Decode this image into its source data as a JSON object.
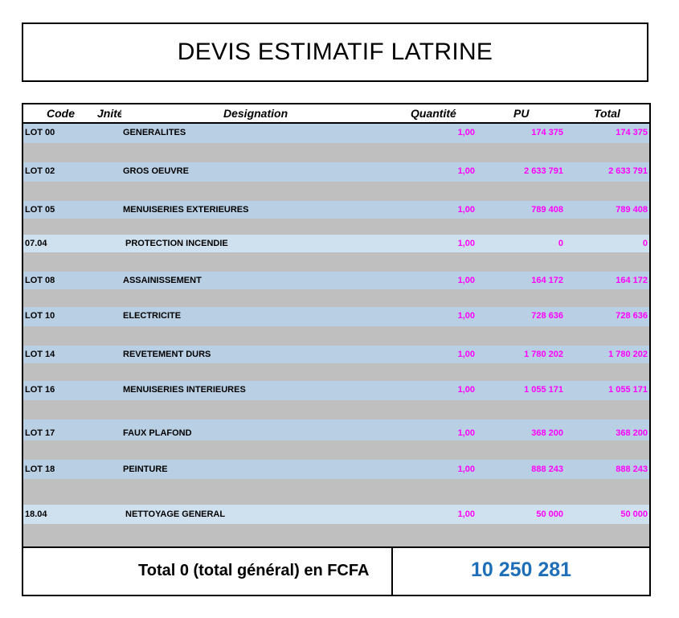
{
  "title": "DEVIS ESTIMATIF LATRINE",
  "header": {
    "code": "Code",
    "unite": "Jnité",
    "designation": "Designation",
    "quantite": "Quantité",
    "pu": "PU",
    "total": "Total"
  },
  "colors": {
    "row_blue": "#b8cfe4",
    "row_light": "#cfe0ef",
    "row_gray": "#bfbfbf",
    "value_magenta": "#ff00ff",
    "total_blue": "#1f6fb8"
  },
  "rows": [
    {
      "code": "LOT 00",
      "designation": "GENERALITES",
      "quantite": "1,00",
      "pu": "174 375",
      "total": "174 375"
    },
    {
      "code": "LOT 02",
      "designation": "GROS OEUVRE",
      "quantite": "1,00",
      "pu": "2 633 791",
      "total": "2 633 791"
    },
    {
      "code": "LOT 05",
      "designation": "MENUISERIES EXTERIEURES",
      "quantite": "1,00",
      "pu": "789 408",
      "total": "789 408"
    },
    {
      "code": "07.04",
      "designation": "PROTECTION INCENDIE",
      "quantite": "1,00",
      "pu": "0",
      "total": "0"
    },
    {
      "code": "LOT 08",
      "designation": "ASSAINISSEMENT",
      "quantite": "1,00",
      "pu": "164 172",
      "total": "164 172"
    },
    {
      "code": "LOT 10",
      "designation": "ELECTRICITE",
      "quantite": "1,00",
      "pu": "728 636",
      "total": "728 636"
    },
    {
      "code": "LOT 14",
      "designation": "REVETEMENT DURS",
      "quantite": "1,00",
      "pu": "1 780 202",
      "total": "1 780 202"
    },
    {
      "code": "LOT 16",
      "designation": "MENUISERIES INTERIEURES",
      "quantite": "1,00",
      "pu": "1 055 171",
      "total": "1 055 171"
    },
    {
      "code": "LOT 17",
      "designation": "FAUX PLAFOND",
      "quantite": "1,00",
      "pu": "368 200",
      "total": "368 200"
    },
    {
      "code": "LOT 18",
      "designation": "PEINTURE",
      "quantite": "1,00",
      "pu": "888 243",
      "total": "888 243"
    },
    {
      "code": "18.04",
      "designation": "NETTOYAGE GENERAL",
      "quantite": "1,00",
      "pu": "50 000",
      "total": "50 000"
    }
  ],
  "footer": {
    "label": "Total 0 (total général) en FCFA",
    "amount": "10 250 281"
  }
}
